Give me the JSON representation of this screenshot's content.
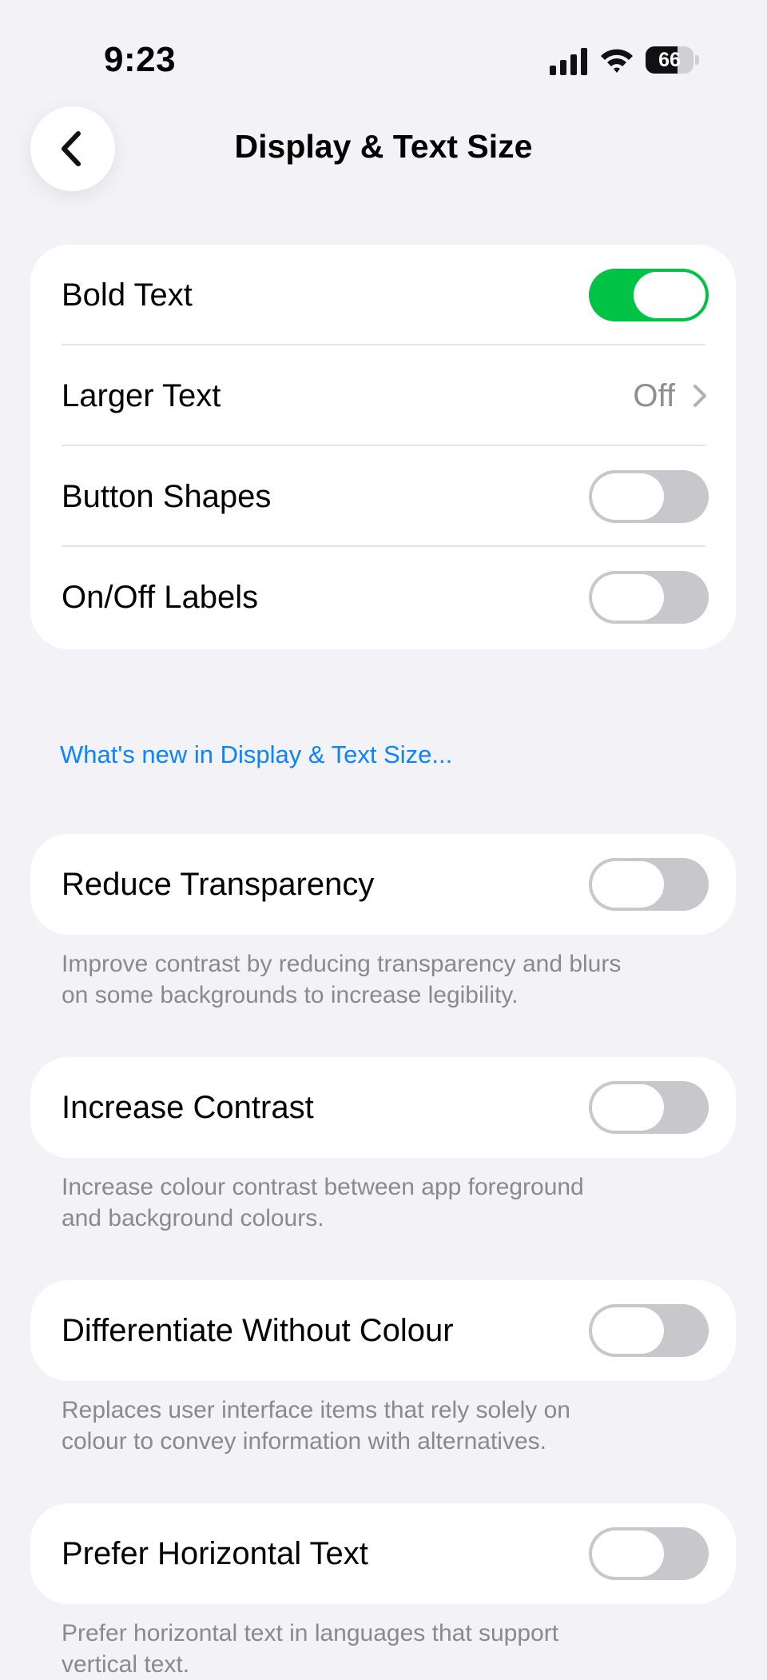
{
  "status_bar": {
    "time": "9:23",
    "battery_level": "66",
    "icons": [
      "cellular-signal-icon",
      "wifi-icon",
      "battery-icon"
    ]
  },
  "nav": {
    "title": "Display & Text Size",
    "back_icon": "chevron-left-icon"
  },
  "group1": {
    "bold_text": {
      "label": "Bold Text",
      "state": "on"
    },
    "larger_text": {
      "label": "Larger Text",
      "value": "Off"
    },
    "button_shapes": {
      "label": "Button Shapes",
      "state": "off"
    },
    "onoff_labels": {
      "label": "On/Off Labels",
      "state": "off"
    }
  },
  "whats_new_link": "What's new in Display & Text Size...",
  "reduce_transparency": {
    "label": "Reduce Transparency",
    "state": "off",
    "footer_line1": "Improve contrast by reducing transparency and blurs",
    "footer_line2": "on some backgrounds to increase legibility."
  },
  "increase_contrast": {
    "label": "Increase Contrast",
    "state": "off",
    "footer_line1": "Increase colour contrast between app foreground",
    "footer_line2": "and background colours."
  },
  "differentiate_without_colour": {
    "label": "Differentiate Without Colour",
    "state": "off",
    "footer_line1": "Replaces user interface items that rely solely on",
    "footer_line2": "colour to convey information with alternatives."
  },
  "prefer_horizontal_text": {
    "label": "Prefer Horizontal Text",
    "state": "off",
    "footer_line1": "Prefer horizontal text in languages that support",
    "footer_line2": "vertical text."
  },
  "colors": {
    "toggle_on": "#00C244",
    "toggle_off": "#C7C7CC",
    "link": "#0A84FF",
    "background": "#F2F2F7"
  }
}
